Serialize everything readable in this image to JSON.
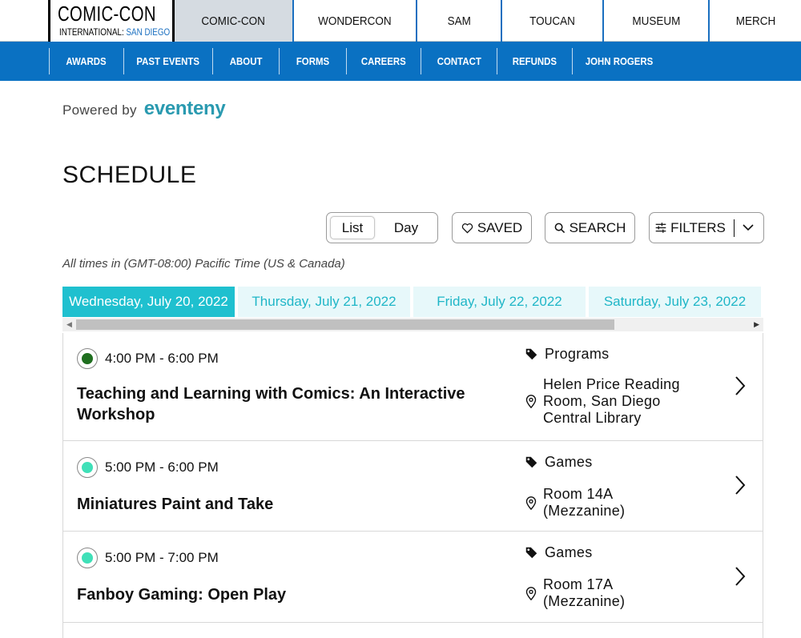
{
  "logo": {
    "line1": "COMIC-CON",
    "line2a": "INTERNATIONAL: ",
    "line2b": "SAN DIEGO"
  },
  "top_tabs": [
    {
      "label": "COMIC-CON",
      "active": true
    },
    {
      "label": "WONDERCON"
    },
    {
      "label": "SAM"
    },
    {
      "label": "TOUCAN"
    },
    {
      "label": "MUSEUM"
    },
    {
      "label": "MERCH"
    }
  ],
  "sub_nav": [
    "AWARDS",
    "PAST EVENTS",
    "ABOUT",
    "FORMS",
    "CAREERS",
    "CONTACT",
    "REFUNDS",
    "JOHN ROGERS"
  ],
  "powered": {
    "prefix": "Powered by",
    "brand": "eventeny"
  },
  "page_title": "SCHEDULE",
  "toolbar": {
    "list_label": "List",
    "day_label": "Day",
    "saved_label": "SAVED",
    "search_label": "SEARCH",
    "filters_label": "FILTERS"
  },
  "timezone_note": "All times in (GMT-08:00) Pacific Time (US & Canada)",
  "dates": [
    {
      "label": "Wednesday, July 20, 2022",
      "active": true
    },
    {
      "label": "Thursday, July 21, 2022"
    },
    {
      "label": "Friday, July 22, 2022"
    },
    {
      "label": "Saturday, July 23, 2022"
    }
  ],
  "colors": {
    "brand_blue": "#0a71c2",
    "teal": "#1fc0cf",
    "dot_dark_green": "#1f6e1f",
    "dot_mint": "#3fe0b8"
  },
  "events": [
    {
      "time": "4:00 PM - 6:00 PM",
      "title_line1": "Teaching and Learning with Comics: An Interactive",
      "title_line2": "Workshop",
      "category": "Programs",
      "loc_line1": "Helen Price Reading",
      "loc_line2": "Room, San Diego",
      "loc_line3": "Central Library",
      "dot": "dark-green"
    },
    {
      "time": "5:00 PM - 6:00 PM",
      "title_line1": "Miniatures Paint and Take",
      "category": "Games",
      "loc_line1": "Room 14A",
      "loc_line2": "(Mezzanine)",
      "dot": "mint"
    },
    {
      "time": "5:00 PM - 7:00 PM",
      "title_line1": "Fanboy Gaming: Open Play",
      "category": "Games",
      "loc_line1": "Room 17A",
      "loc_line2": "(Mezzanine)",
      "dot": "mint"
    }
  ]
}
